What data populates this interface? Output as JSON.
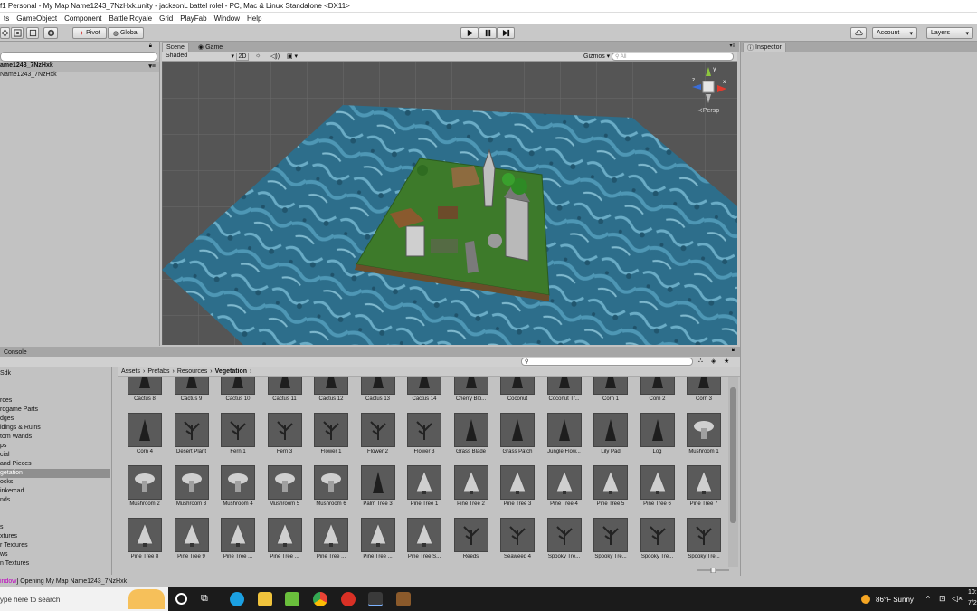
{
  "title_bar": "f1 Personal - My Map Name1243_7NzHxk.unity - jacksonL battel rolel - PC, Mac & Linux Standalone <DX11>",
  "menu": [
    "ts",
    "GameObject",
    "Component",
    "Battle Royale",
    "Grid",
    "PlayFab",
    "Window",
    "Help"
  ],
  "toolbar": {
    "pivot": "Pivot",
    "global": "Global",
    "account": "Account",
    "layers": "Layers"
  },
  "hierarchy": {
    "scene_name": "ame1243_7NzHxk",
    "item": "Name1243_7NzHxk"
  },
  "scene": {
    "tabs": [
      "Scene",
      "Game"
    ],
    "shading": "Shaded",
    "mode_2d": "2D",
    "gizmos": "Gizmos",
    "search_placeholder": "All",
    "persp": "Persp"
  },
  "inspector": {
    "tab": "Inspector"
  },
  "console": {
    "tab": "Console"
  },
  "project_folders": [
    "Sdk",
    "",
    "",
    "rces",
    "rdgame Parts",
    "dges",
    "ldings & Ruins",
    "tom Wands",
    "ps",
    "cial",
    "and Pieces",
    "getation",
    "ocks",
    "inkercad",
    "nds",
    "",
    "",
    "s",
    "xtures",
    "r Textures",
    "ws",
    "n Textures"
  ],
  "selected_folder_index": 11,
  "breadcrumb": {
    "parts": [
      "Assets",
      "Prefabs",
      "Resources"
    ],
    "current": "Vegetation"
  },
  "assets": [
    "Cactus 8",
    "Cactus 9",
    "Cactus 10",
    "Cactus 11",
    "Cactus 12",
    "Cactus 13",
    "Cactus 14",
    "Cherry Blo...",
    "Coconut",
    "Coconut Tr...",
    "Corn 1",
    "Corn 2",
    "Corn 3",
    "Corn 4",
    "Desert Plant",
    "Fern 1",
    "Fern 3",
    "Flower 1",
    "Flower 2",
    "Flower 3",
    "Grass Blade",
    "Grass Patch",
    "Jungle Flow...",
    "Lily Pad",
    "Log",
    "Mushroom 1",
    "Mushroom 2",
    "Mushroom 3",
    "Mushroom 4",
    "Mushroom 5",
    "Mushroom 6",
    "Palm Tree 3",
    "Pine Tree 1",
    "Pine Tree 2",
    "Pine Tree 3",
    "Pine Tree 4",
    "Pine Tree 5",
    "Pine Tree 6",
    "Pine Tree 7",
    "Pine Tree 8",
    "Pine Tree 9",
    "Pine Tree ...",
    "Pine Tree ...",
    "Pine Tree ...",
    "Pine Tree ...",
    "Pine Tree S...",
    "Reeds",
    "Seaweed 4",
    "Spooky Tre...",
    "Spooky Tre...",
    "Spooky Tre...",
    "Spooky Tre..."
  ],
  "status": {
    "prefix": "indow",
    "message": "Opening My Map Name1243_7NzHxk"
  },
  "taskbar": {
    "search_placeholder": "ype here to search",
    "weather": "86°F  Sunny",
    "time": "10:",
    "date": "7/2"
  }
}
